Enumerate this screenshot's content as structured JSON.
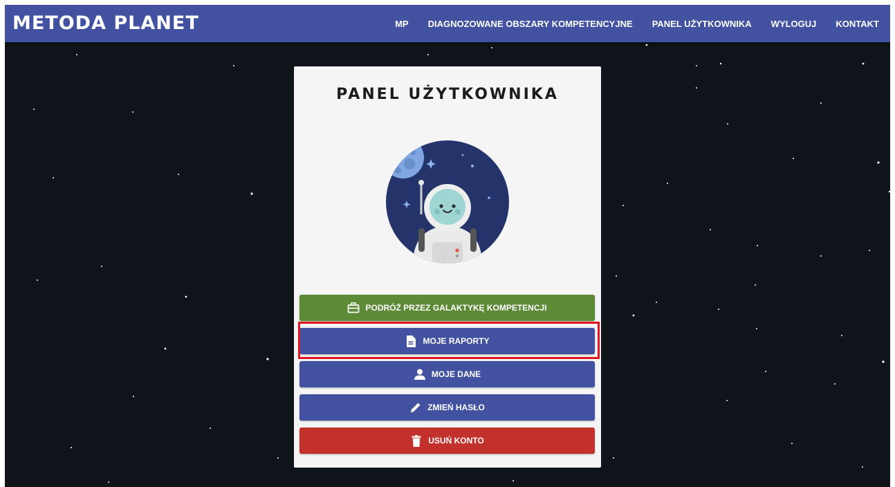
{
  "navbar": {
    "brand": "METODA PLANET",
    "links": [
      {
        "label": "MP"
      },
      {
        "label": "DIAGNOZOWANE OBSZARY KOMPETENCYJNE"
      },
      {
        "label": "PANEL UŻYTKOWNIKA"
      },
      {
        "label": "WYLOGUJ"
      },
      {
        "label": "KONTAKT"
      }
    ]
  },
  "panel": {
    "title": "PANEL UŻYTKOWNIKA",
    "buttons": [
      {
        "label": "PODRÓŻ PRZEZ GALAKTYKĘ KOMPETENCJI",
        "icon": "briefcase-icon"
      },
      {
        "label": "MOJE RAPORTY",
        "icon": "document-icon"
      },
      {
        "label": "MOJE DANE",
        "icon": "user-icon"
      },
      {
        "label": "ZMIEŃ HASŁO",
        "icon": "pencil-icon"
      },
      {
        "label": "USUŃ KONTO",
        "icon": "trash-icon"
      }
    ]
  },
  "colors": {
    "navbar": "#4252a0",
    "background": "#0f141b",
    "green_button": "#5d8a37",
    "blue_button": "#4252a0",
    "red_button": "#c2312c",
    "highlight": "#e0161c"
  }
}
